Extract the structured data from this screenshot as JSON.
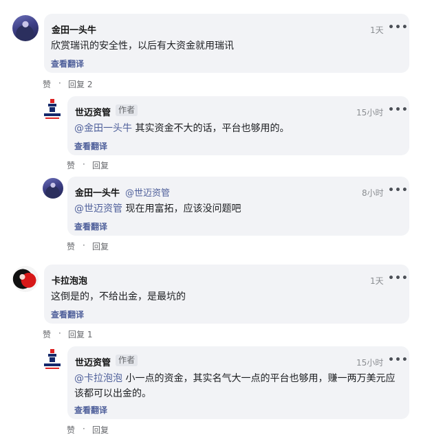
{
  "comments": [
    {
      "author": "金田一头牛",
      "time": "1天",
      "text": "欣赏瑞讯的安全性，以后有大资金就用瑞讯",
      "translate": "查看翻译",
      "like": "赞",
      "reply": "回复 2"
    },
    {
      "author": "世迈资管",
      "author_tag": "作者",
      "time": "15小时",
      "mention": "@金田一头牛",
      "text": " 其实资金不大的话，平台也够用的。",
      "translate": "查看翻译",
      "like": "赞",
      "reply": "回复"
    },
    {
      "author": "金田一头牛",
      "reply_to": "@世迈资管",
      "time": "8小时",
      "mention": "@世迈资管",
      "text": " 现在用富拓，应该没问题吧",
      "translate": "查看翻译",
      "like": "赞",
      "reply": "回复"
    },
    {
      "author": "卡拉泡泡",
      "time": "1天",
      "text": "这倒是的，不给出金，是最坑的",
      "translate": "查看翻译",
      "like": "赞",
      "reply": "回复 1"
    },
    {
      "author": "世迈资管",
      "author_tag": "作者",
      "time": "15小时",
      "mention": "@卡拉泡泡",
      "text": " 小一点的资金，其实名气大一点的平台也够用，赚一两万美元应该都可以出金的。",
      "translate": "查看翻译",
      "like": "赞",
      "reply": "回复"
    }
  ],
  "more_label": "•••",
  "separator": "·"
}
